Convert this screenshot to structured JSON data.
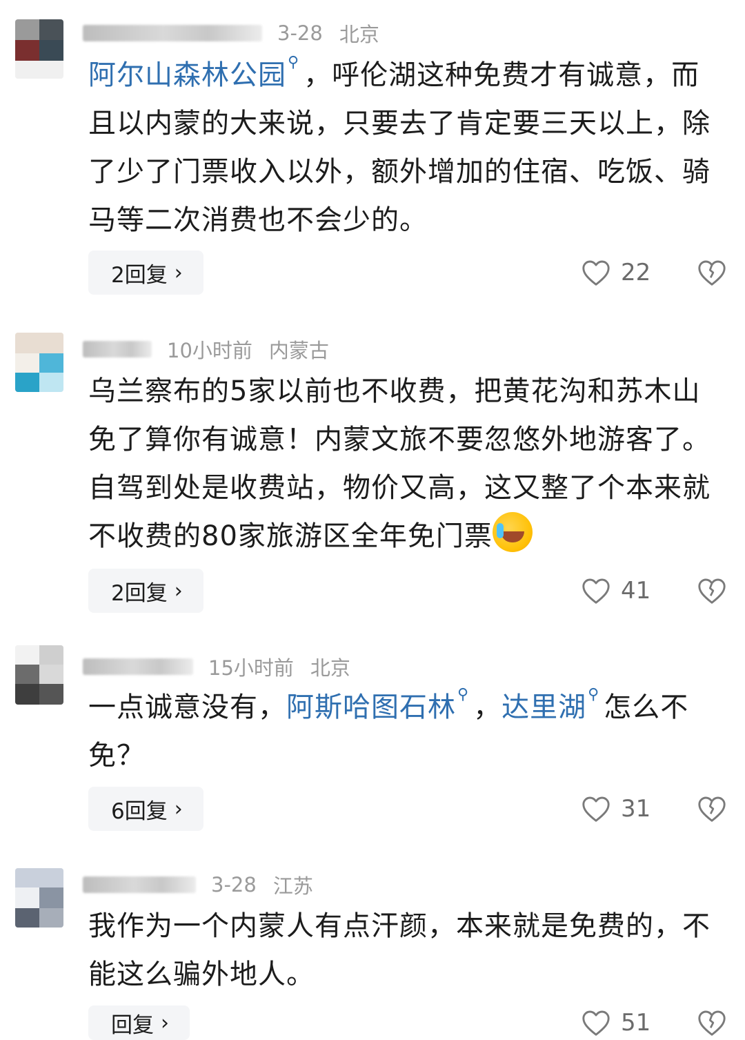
{
  "comments": [
    {
      "time": "3-28",
      "location": "北京",
      "segments": [
        {
          "text": "阿尔山森林公园",
          "link": true
        },
        {
          "text": "，呼伦湖这种免费才有诚意，而且以内蒙的大来说，只要去了肯定要三天以上，除了少了门票收入以外，额外增加的住宿、吃饭、骑马等二次消费也不会少的。",
          "link": false
        }
      ],
      "reply_label": "2回复",
      "like_count": "22"
    },
    {
      "time": "10小时前",
      "location": "内蒙古",
      "segments": [
        {
          "text": "乌兰察布的5家以前也不收费，把黄花沟和苏木山免了算你有诚意！内蒙文旅不要忽悠外地游客了。自驾到处是收费站，物价又高，这又整了个本来就不收费的80家旅游区全年免门票",
          "link": false
        }
      ],
      "emoji": "crying-laughing-emoji",
      "reply_label": "2回复",
      "like_count": "41"
    },
    {
      "time": "15小时前",
      "location": "北京",
      "segments": [
        {
          "text": "一点诚意没有，",
          "link": false
        },
        {
          "text": "阿斯哈图石林",
          "link": true
        },
        {
          "text": "，",
          "link": false
        },
        {
          "text": "达里湖",
          "link": true
        },
        {
          "text": "怎么不免？",
          "link": false
        }
      ],
      "reply_label": "6回复",
      "like_count": "31"
    },
    {
      "time": "3-28",
      "location": "江苏",
      "segments": [
        {
          "text": "我作为一个内蒙人有点汗颜，本来就是免费的，不能这么骗外地人。",
          "link": false
        }
      ],
      "reply_label": "回复",
      "like_count": "51"
    }
  ],
  "icons": {
    "search_mark": "⚲",
    "chevron": "›",
    "like_icon": "heart-outline-icon",
    "dislike_icon": "broken-heart-icon"
  },
  "colors": {
    "link": "#2f6fb0",
    "meta": "#9a9a9a",
    "reply_bg": "#f4f5f7"
  }
}
